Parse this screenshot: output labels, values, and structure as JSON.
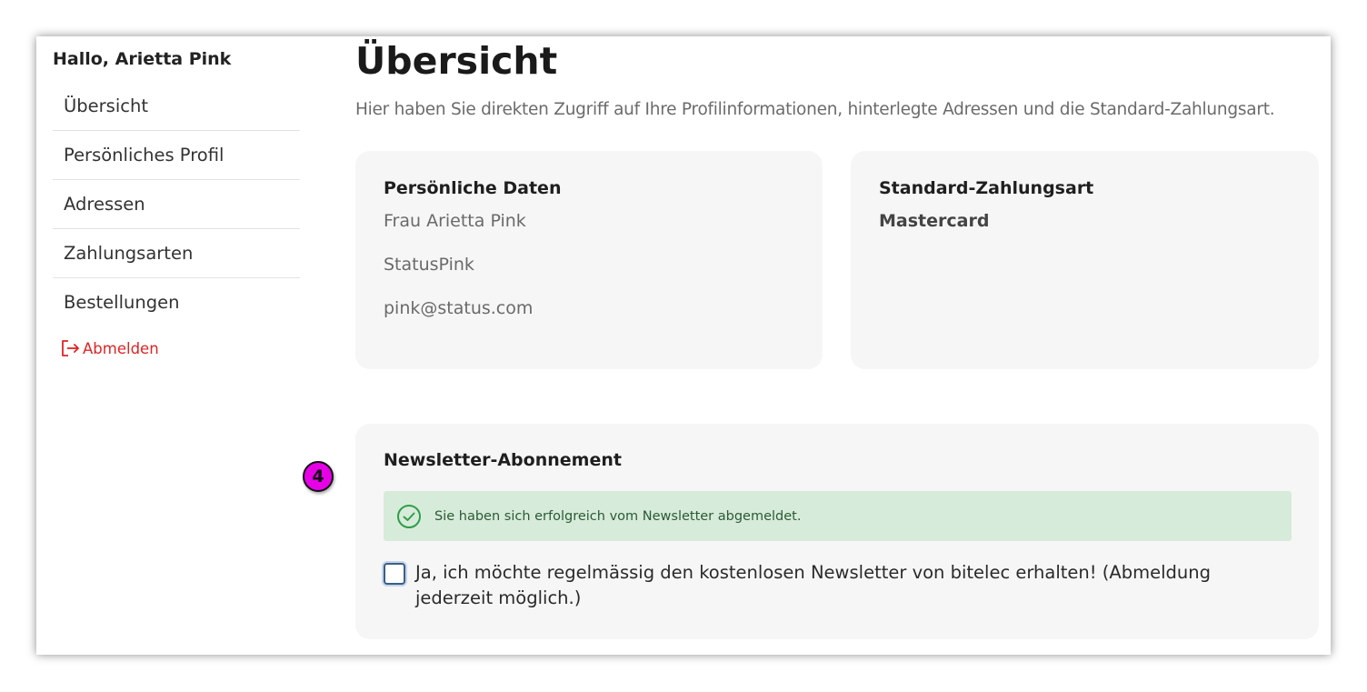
{
  "sidebar": {
    "greeting": "Hallo, Arietta Pink",
    "items": [
      {
        "label": "Übersicht"
      },
      {
        "label": "Persönliches Profil"
      },
      {
        "label": "Adressen"
      },
      {
        "label": "Zahlungsarten"
      },
      {
        "label": "Bestellungen"
      }
    ],
    "logout_label": "Abmelden"
  },
  "main": {
    "title": "Übersicht",
    "subtitle": "Hier haben Sie direkten Zugriff auf Ihre Profilinformationen, hinterlegte Adressen und die Standard-Zahlungsart.",
    "personal": {
      "title": "Persönliche Daten",
      "name": "Frau Arietta Pink",
      "company": "StatusPink",
      "email": "pink@status.com"
    },
    "payment": {
      "title": "Standard-Zahlungsart",
      "method": "Mastercard"
    },
    "newsletter": {
      "title": "Newsletter-Abonnement",
      "alert": "Sie haben sich erfolgreich vom Newsletter abgemeldet.",
      "checkbox_label": "Ja, ich möchte regelmässig den kostenlosen Newsletter von bitelec erhalten! (Abmeldung jederzeit möglich.)",
      "checked": false
    }
  },
  "step_badge": "4",
  "colors": {
    "logout": "#e02424",
    "alert_bg": "#d7ebda",
    "alert_icon": "#2e9e48",
    "badge": "#e600e6",
    "card_bg": "#f6f6f6"
  },
  "icons": {
    "logout": "logout-icon",
    "alert": "check-circle-icon"
  }
}
